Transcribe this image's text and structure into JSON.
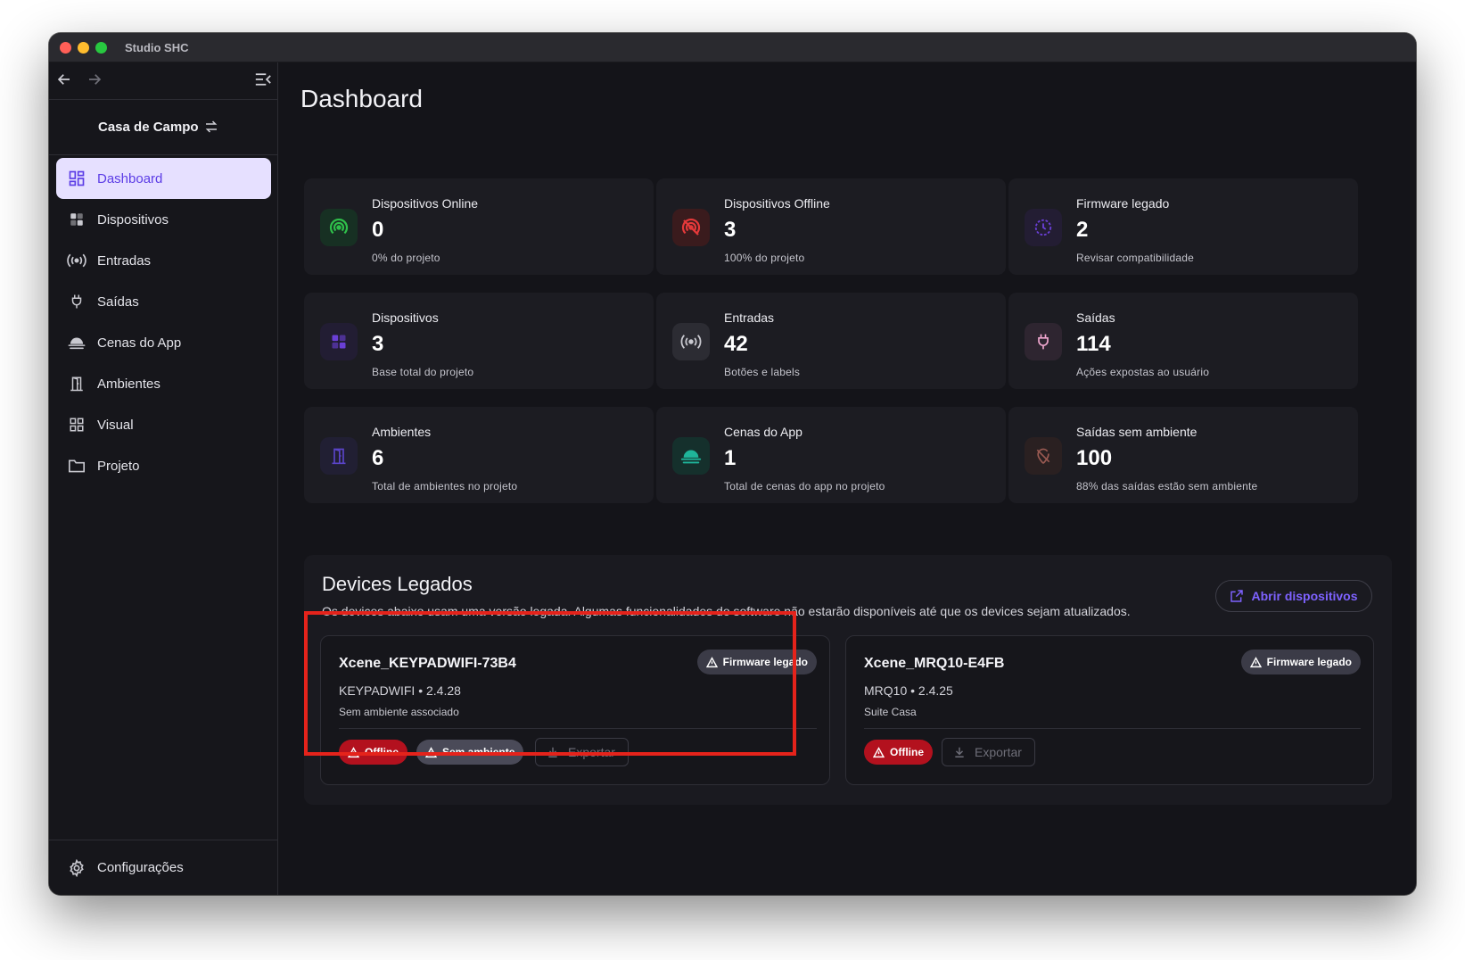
{
  "window": {
    "title": "Studio SHC"
  },
  "sidebar": {
    "project_name": "Casa de Campo",
    "items": [
      {
        "label": "Dashboard",
        "icon": "dashboard-icon",
        "active": true
      },
      {
        "label": "Dispositivos",
        "icon": "devices-icon",
        "active": false
      },
      {
        "label": "Entradas",
        "icon": "broadcast-icon",
        "active": false
      },
      {
        "label": "Saídas",
        "icon": "plug-icon",
        "active": false
      },
      {
        "label": "Cenas do App",
        "icon": "cloud-icon",
        "active": false
      },
      {
        "label": "Ambientes",
        "icon": "door-icon",
        "active": false
      },
      {
        "label": "Visual",
        "icon": "grid-icon",
        "active": false
      },
      {
        "label": "Projeto",
        "icon": "folder-icon",
        "active": false
      }
    ],
    "settings_label": "Configurações"
  },
  "page": {
    "title": "Dashboard"
  },
  "stats": [
    {
      "label": "Dispositivos Online",
      "value": "0",
      "sub": "0% do projeto",
      "icon": "wifi-online-icon",
      "color": "#2fbf4a"
    },
    {
      "label": "Dispositivos Offline",
      "value": "3",
      "sub": "100% do projeto",
      "icon": "wifi-offline-icon",
      "color": "#e5393a"
    },
    {
      "label": "Firmware legado",
      "value": "2",
      "sub": "Revisar compatibilidade",
      "icon": "history-icon",
      "color": "#6a3fd6"
    },
    {
      "label": "Dispositivos",
      "value": "3",
      "sub": "Base total do projeto",
      "icon": "devices-icon",
      "color": "#6a3fd6"
    },
    {
      "label": "Entradas",
      "value": "42",
      "sub": "Botões e labels",
      "icon": "broadcast-icon",
      "color": "#c9c9d0"
    },
    {
      "label": "Saídas",
      "value": "114",
      "sub": "Ações expostas ao usuário",
      "icon": "plug-icon",
      "color": "#f0a7cf"
    },
    {
      "label": "Ambientes",
      "value": "6",
      "sub": "Total de ambientes no projeto",
      "icon": "door-icon",
      "color": "#5a44c8"
    },
    {
      "label": "Cenas do App",
      "value": "1",
      "sub": "Total de cenas do app no projeto",
      "icon": "cloud-icon",
      "color": "#1fb59a"
    },
    {
      "label": "Saídas sem ambiente",
      "value": "100",
      "sub": "88% das saídas estão sem ambiente",
      "icon": "location-off-icon",
      "color": "#9a5a52"
    }
  ],
  "legacy": {
    "title": "Devices Legados",
    "description": "Os devices abaixo usam uma versão legada. Algumas funcionalidades do software não estarão disponíveis até que os devices sejam atualizados.",
    "open_button": "Abrir dispositivos",
    "devices": [
      {
        "name": "Xcene_KEYPADWIFI-73B4",
        "model": "KEYPADWIFI • 2.4.28",
        "room": "Sem ambiente associado",
        "badge": "Firmware legado",
        "status": "Offline",
        "room_chip": "Sem ambiente",
        "export": "Exportar"
      },
      {
        "name": "Xcene_MRQ10-E4FB",
        "model": "MRQ10 • 2.4.25",
        "room": "Suite Casa",
        "badge": "Firmware legado",
        "status": "Offline",
        "export": "Exportar"
      }
    ]
  }
}
